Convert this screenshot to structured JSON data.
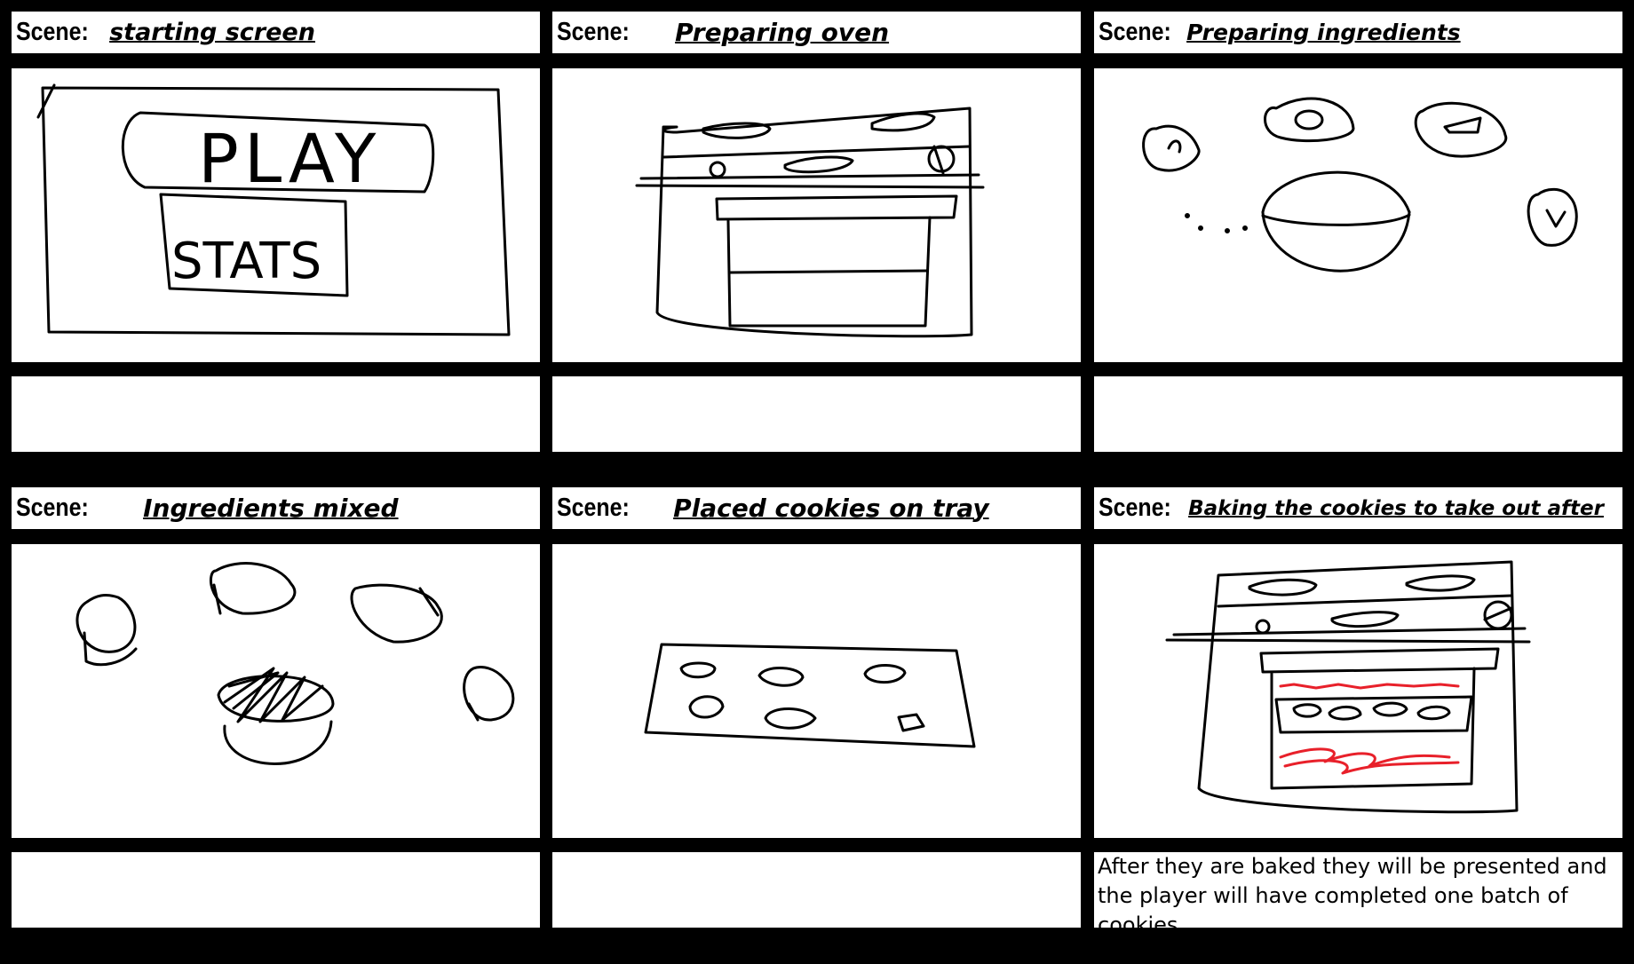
{
  "storyboard": {
    "scene_label": "Scene:",
    "panels": [
      {
        "title": "starting screen",
        "sketch": "start-menu-sketch",
        "play_text": "PLAY",
        "stats_text": "STATS",
        "note": ""
      },
      {
        "title": "Preparing oven",
        "sketch": "oven-sketch",
        "note": ""
      },
      {
        "title": "Preparing ingredients",
        "sketch": "ingredients-bowls-sketch",
        "note": ""
      },
      {
        "title": "Ingredients mixed",
        "sketch": "mixed-bowl-sketch",
        "note": ""
      },
      {
        "title": "Placed cookies on tray",
        "sketch": "cookie-tray-sketch",
        "note": ""
      },
      {
        "title": "Baking the cookies to take out after",
        "sketch": "baking-oven-sketch",
        "note": "After they are baked they will be presented and the player will have completed one batch of cookies"
      }
    ]
  },
  "colors": {
    "ink": "#000000",
    "red_ink": "#e8202a",
    "background": "#000000",
    "panel": "#ffffff"
  }
}
